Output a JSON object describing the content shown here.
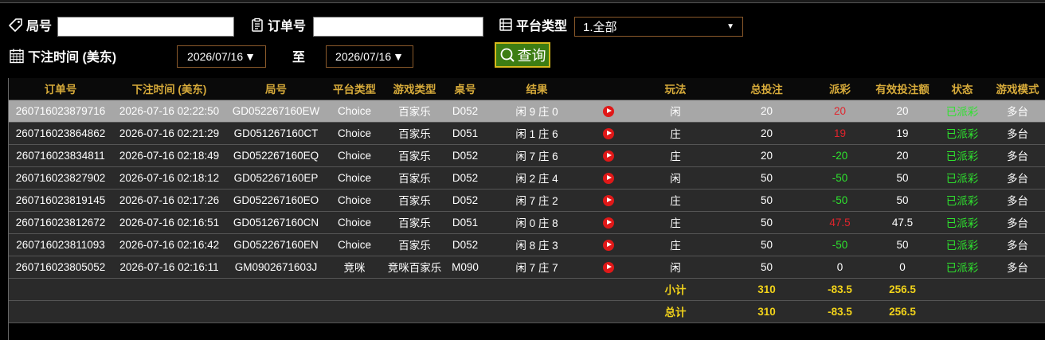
{
  "filters": {
    "round_label": "局号",
    "round_value": "",
    "order_label": "订单号",
    "order_value": "",
    "platform_label": "平台类型",
    "platform_selected": "1.全部",
    "bettime_label": "下注时间 (美东)",
    "date_from": "2026/07/16",
    "to_label": "至",
    "date_to": "2026/07/16",
    "query_label": "查询"
  },
  "table": {
    "headers": [
      "订单号",
      "下注时间 (美东)",
      "局号",
      "平台类型",
      "游戏类型",
      "桌号",
      "结果",
      "",
      "玩法",
      "总投注",
      "派彩",
      "有效投注额",
      "状态",
      "游戏模式"
    ],
    "rows": [
      {
        "order": "260716023879716",
        "time": "2026-07-16 02:22:50",
        "round": "GD052267160EW",
        "platform": "Choice",
        "game": "百家乐",
        "table": "D052",
        "result": "闲 9 庄 0",
        "play": "闲",
        "bet": "20",
        "payout": "20",
        "payout_color": "#e0242c",
        "valid": "20",
        "status": "已派彩",
        "mode": "多台",
        "selected": true
      },
      {
        "order": "260716023864862",
        "time": "2026-07-16 02:21:29",
        "round": "GD051267160CT",
        "platform": "Choice",
        "game": "百家乐",
        "table": "D051",
        "result": "闲 1 庄 6",
        "play": "庄",
        "bet": "20",
        "payout": "19",
        "payout_color": "#e0242c",
        "valid": "19",
        "status": "已派彩",
        "mode": "多台",
        "selected": false
      },
      {
        "order": "260716023834811",
        "time": "2026-07-16 02:18:49",
        "round": "GD052267160EQ",
        "platform": "Choice",
        "game": "百家乐",
        "table": "D052",
        "result": "闲 7 庄 6",
        "play": "庄",
        "bet": "20",
        "payout": "-20",
        "payout_color": "#2ee32e",
        "valid": "20",
        "status": "已派彩",
        "mode": "多台",
        "selected": false
      },
      {
        "order": "260716023827902",
        "time": "2026-07-16 02:18:12",
        "round": "GD052267160EP",
        "platform": "Choice",
        "game": "百家乐",
        "table": "D052",
        "result": "闲 2 庄 4",
        "play": "闲",
        "bet": "50",
        "payout": "-50",
        "payout_color": "#2ee32e",
        "valid": "50",
        "status": "已派彩",
        "mode": "多台",
        "selected": false
      },
      {
        "order": "260716023819145",
        "time": "2026-07-16 02:17:26",
        "round": "GD052267160EO",
        "platform": "Choice",
        "game": "百家乐",
        "table": "D052",
        "result": "闲 7 庄 2",
        "play": "庄",
        "bet": "50",
        "payout": "-50",
        "payout_color": "#2ee32e",
        "valid": "50",
        "status": "已派彩",
        "mode": "多台",
        "selected": false
      },
      {
        "order": "260716023812672",
        "time": "2026-07-16 02:16:51",
        "round": "GD051267160CN",
        "platform": "Choice",
        "game": "百家乐",
        "table": "D051",
        "result": "闲 0 庄 8",
        "play": "庄",
        "bet": "50",
        "payout": "47.5",
        "payout_color": "#e0242c",
        "valid": "47.5",
        "status": "已派彩",
        "mode": "多台",
        "selected": false
      },
      {
        "order": "260716023811093",
        "time": "2026-07-16 02:16:42",
        "round": "GD052267160EN",
        "platform": "Choice",
        "game": "百家乐",
        "table": "D052",
        "result": "闲 8 庄 3",
        "play": "庄",
        "bet": "50",
        "payout": "-50",
        "payout_color": "#2ee32e",
        "valid": "50",
        "status": "已派彩",
        "mode": "多台",
        "selected": false
      },
      {
        "order": "260716023805052",
        "time": "2026-07-16 02:16:11",
        "round": "GM0902671603J",
        "platform": "竞咪",
        "game": "竞咪百家乐",
        "table": "M090",
        "result": "闲 7 庄 7",
        "play": "闲",
        "bet": "50",
        "payout": "0",
        "payout_color": "#ffffff",
        "valid": "0",
        "status": "已派彩",
        "mode": "多台",
        "selected": false
      }
    ],
    "subtotal": {
      "label": "小计",
      "bet": "310",
      "payout": "-83.5",
      "valid": "256.5"
    },
    "total": {
      "label": "总计",
      "bet": "310",
      "payout": "-83.5",
      "valid": "256.5"
    }
  },
  "colors": {
    "header_text": "#d6aa3a",
    "status_green": "#2ee32e",
    "sum_yellow": "#f2d31a",
    "selected_row": "#a7a7a7"
  }
}
